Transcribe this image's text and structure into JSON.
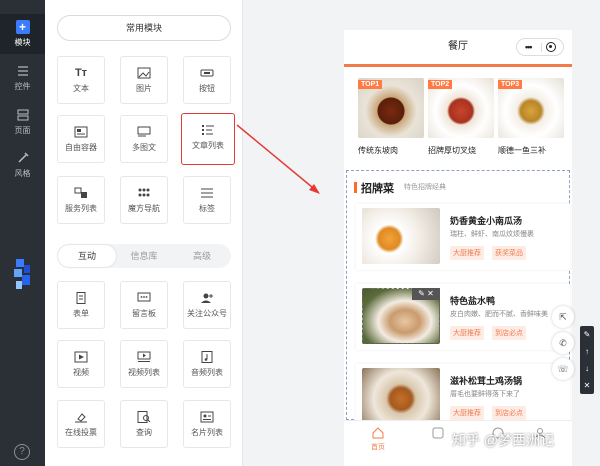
{
  "rail": {
    "items": [
      {
        "label": "模块",
        "icon": "plus-icon"
      },
      {
        "label": "控件",
        "icon": "controls-icon"
      },
      {
        "label": "页面",
        "icon": "page-icon"
      },
      {
        "label": "风格",
        "icon": "style-icon"
      }
    ],
    "help": "?"
  },
  "panel": {
    "common_label": "常用模块",
    "tiles": [
      {
        "label": "文本",
        "icon": "text-icon"
      },
      {
        "label": "图片",
        "icon": "image-icon"
      },
      {
        "label": "按钮",
        "icon": "button-icon"
      },
      {
        "label": "自由容器",
        "icon": "container-icon"
      },
      {
        "label": "多图文",
        "icon": "multi-image-text-icon"
      },
      {
        "label": "文章列表",
        "icon": "article-list-icon"
      },
      {
        "label": "服务列表",
        "icon": "service-list-icon"
      },
      {
        "label": "魔方导航",
        "icon": "grid-nav-icon"
      },
      {
        "label": "标签",
        "icon": "tag-icon"
      }
    ],
    "tabs": [
      "互动",
      "信息库",
      "高级"
    ],
    "tiles2": [
      {
        "label": "表单",
        "icon": "form-icon"
      },
      {
        "label": "留言板",
        "icon": "message-board-icon"
      },
      {
        "label": "关注公众号",
        "icon": "follow-icon"
      },
      {
        "label": "视频",
        "icon": "video-icon"
      },
      {
        "label": "视频列表",
        "icon": "video-list-icon"
      },
      {
        "label": "音频列表",
        "icon": "audio-list-icon"
      },
      {
        "label": "在线投票",
        "icon": "vote-icon"
      },
      {
        "label": "查询",
        "icon": "query-icon"
      },
      {
        "label": "名片列表",
        "icon": "card-list-icon"
      }
    ]
  },
  "phone": {
    "title": "餐厅",
    "capsule_dots": "•••",
    "top_items": [
      {
        "badge": "TOP1",
        "name": "传统东坡肉"
      },
      {
        "badge": "TOP2",
        "name": "招牌厚切叉烧"
      },
      {
        "badge": "TOP3",
        "name": "顺德一鱼三补"
      }
    ],
    "section_title": "招牌菜",
    "section_subtitle": "特色招牌经典",
    "articles": [
      {
        "title": "奶香黄金小南瓜汤",
        "desc": "瑞柱、鲜虾、南瓜炆烦慢裹",
        "tags": [
          "大厨推荐",
          "获奖菜品"
        ]
      },
      {
        "title": "特色盐水鸭",
        "desc": "皮白肉嫩、肥而不腻、香鲜味美",
        "tags": [
          "大厨推荐",
          "到店必点"
        ]
      },
      {
        "title": "滋补松茸土鸡汤锅",
        "desc": "厝毛也要鲜得落下来了",
        "tags": [
          "大厨推荐",
          "到店必点"
        ]
      }
    ],
    "tab_home": "首页"
  },
  "watermark": "知乎 @梦西洲记",
  "colors": {
    "accent": "#3b7cff",
    "brand_orange": "#f37b4a",
    "highlight_red": "#e53935"
  }
}
